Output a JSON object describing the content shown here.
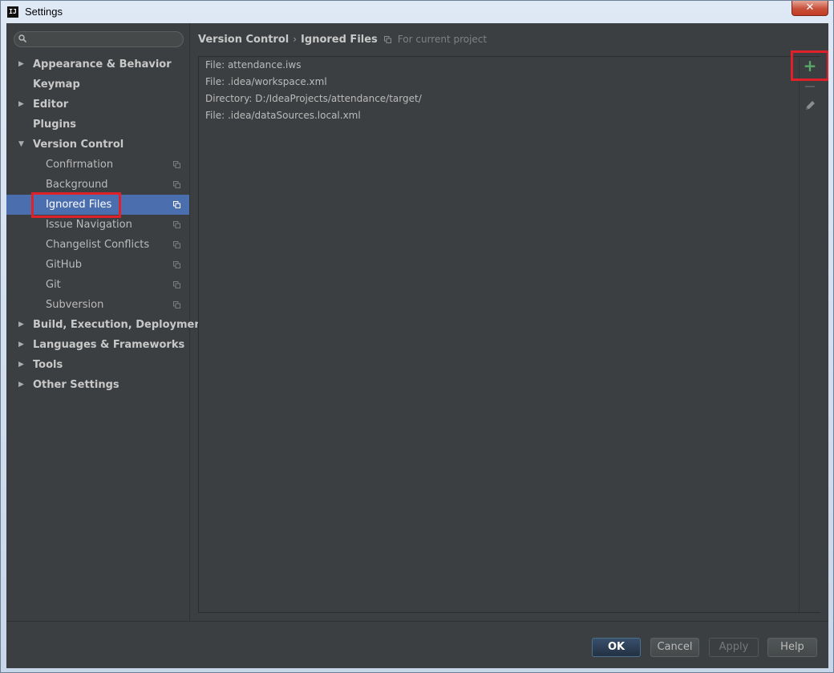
{
  "window": {
    "title": "Settings",
    "app_icon_text": "IJ",
    "close_glyph": "✕"
  },
  "search": {
    "placeholder": "",
    "value": ""
  },
  "sidebar": {
    "items": [
      {
        "label": "Appearance & Behavior",
        "level": 0,
        "arrow": "▶"
      },
      {
        "label": "Keymap",
        "level": 0,
        "arrow": ""
      },
      {
        "label": "Editor",
        "level": 0,
        "arrow": "▶"
      },
      {
        "label": "Plugins",
        "level": 0,
        "arrow": ""
      },
      {
        "label": "Version Control",
        "level": 0,
        "arrow": "▼"
      },
      {
        "label": "Confirmation",
        "level": 1,
        "arrow": ""
      },
      {
        "label": "Background",
        "level": 1,
        "arrow": ""
      },
      {
        "label": "Ignored Files",
        "level": 1,
        "arrow": "",
        "selected": true
      },
      {
        "label": "Issue Navigation",
        "level": 1,
        "arrow": ""
      },
      {
        "label": "Changelist Conflicts",
        "level": 1,
        "arrow": ""
      },
      {
        "label": "GitHub",
        "level": 1,
        "arrow": ""
      },
      {
        "label": "Git",
        "level": 1,
        "arrow": ""
      },
      {
        "label": "Subversion",
        "level": 1,
        "arrow": ""
      },
      {
        "label": "Build, Execution, Deployment",
        "level": 0,
        "arrow": "▶"
      },
      {
        "label": "Languages & Frameworks",
        "level": 0,
        "arrow": "▶"
      },
      {
        "label": "Tools",
        "level": 0,
        "arrow": "▶"
      },
      {
        "label": "Other Settings",
        "level": 0,
        "arrow": "▶"
      }
    ]
  },
  "breadcrumb": {
    "parent": "Version Control",
    "separator": "›",
    "current": "Ignored Files",
    "hint": "For current project"
  },
  "ignored_files": [
    "File: attendance.iws",
    "File: .idea/workspace.xml",
    "Directory: D:/IdeaProjects/attendance/target/",
    "File: .idea/dataSources.local.xml"
  ],
  "toolbar": {
    "add_glyph": "+",
    "add_icon": "plus-icon",
    "remove_icon": "minus-icon",
    "edit_icon": "pencil-icon"
  },
  "buttons": {
    "ok": "OK",
    "cancel": "Cancel",
    "apply": "Apply",
    "help": "Help"
  },
  "colors": {
    "background": "#3c3f41",
    "selection": "#4b6eaf",
    "highlight_frame": "#e0212a",
    "add_green": "#59a869"
  }
}
